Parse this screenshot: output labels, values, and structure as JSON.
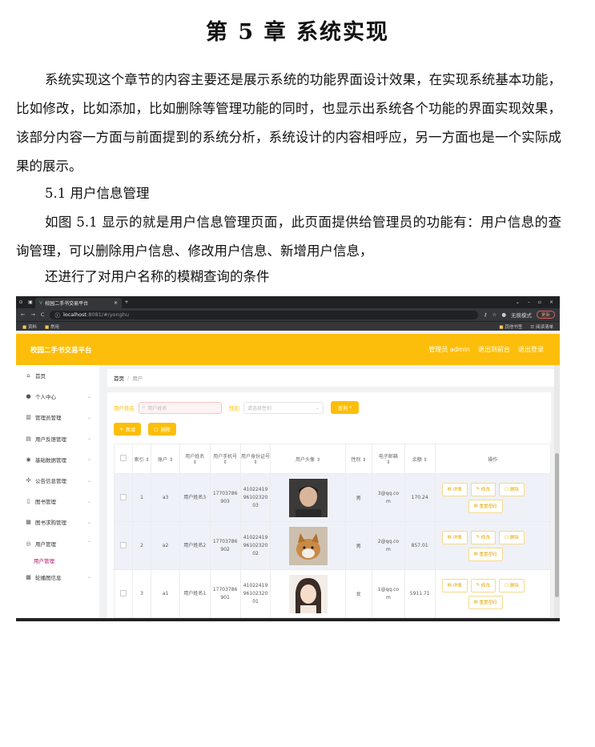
{
  "doc": {
    "chapter_title": "第 5 章  系统实现",
    "para1": "系统实现这个章节的内容主要还是展示系统的功能界面设计效果，在实现系统基本功能，比如修改，比如添加，比如删除等管理功能的同时，也显示出系统各个功能的界面实现效果，该部分内容一方面与前面提到的系统分析，系统设计的内容相呼应，另一方面也是一个实际成果的展示。",
    "section": "5.1 用户信息管理",
    "para2": "如图 5.1 显示的就是用户信息管理页面，此页面提供给管理员的功能有：用户信息的查询管理，可以删除用户信息、修改用户信息、新增用户信息，",
    "para3": "还进行了对用户名称的模糊查询的条件"
  },
  "browser": {
    "tab_title": "校园二手书交易平台",
    "new_tab": "+",
    "url_host": "localhost",
    "url_rest": ":8081/#/yonghu",
    "incognito": "无痕模式",
    "update": "更新",
    "bookmarks": [
      "资料",
      "常用"
    ],
    "bookmarks_right": [
      "其他书签",
      "阅读清单"
    ]
  },
  "app": {
    "brand": "校园二手书交易平台",
    "header_links": [
      "管理员 admin",
      "退出到前台",
      "退出登录"
    ],
    "sidebar": [
      {
        "label": "首页",
        "icon": "home-icon"
      },
      {
        "label": "个人中心",
        "icon": "user-icon"
      },
      {
        "label": "管理员管理",
        "icon": "chart-icon"
      },
      {
        "label": "用户反馈管理",
        "icon": "list-icon"
      },
      {
        "label": "基础数据管理",
        "icon": "pin-icon"
      },
      {
        "label": "公告信息管理",
        "icon": "megaphone-icon"
      },
      {
        "label": "图书管理",
        "icon": "book-icon"
      },
      {
        "label": "图书求购管理",
        "icon": "cart-icon"
      },
      {
        "label": "用户管理",
        "icon": "users-icon"
      },
      {
        "label": "用户管理",
        "icon": ""
      },
      {
        "label": "轮播图信息",
        "icon": "image-icon"
      }
    ],
    "breadcrumb": {
      "home": "首页",
      "sep": "/",
      "current": "用户"
    },
    "search": {
      "name_label": "用户姓名",
      "name_placeholder": "用户姓名",
      "gender_label": "性别",
      "gender_placeholder": "请选择性别",
      "query_button": "查询"
    },
    "add_button": "新增",
    "delete_button": "删除",
    "columns": [
      "索引",
      "账户",
      "用户姓名",
      "用户手机号",
      "用户身份证号",
      "用户头像",
      "性别",
      "电子邮箱",
      "余额",
      "操作"
    ],
    "rows": [
      {
        "index": "1",
        "account": "a3",
        "name": "用户姓名3",
        "phone": "17703786903",
        "idcard": "410224199610232003",
        "gender": "男",
        "email": "3@qq.com",
        "balance": "170.24",
        "avatar": "man"
      },
      {
        "index": "2",
        "account": "a2",
        "name": "用户姓名2",
        "phone": "17703786902",
        "idcard": "410224199610232002",
        "gender": "男",
        "email": "2@qq.com",
        "balance": "857.01",
        "avatar": "dog"
      },
      {
        "index": "3",
        "account": "a1",
        "name": "用户姓名1",
        "phone": "17703786901",
        "idcard": "410224199610232001",
        "gender": "女",
        "email": "1@qq.com",
        "balance": "5911.71",
        "avatar": "woman"
      }
    ],
    "ops": {
      "detail": "详情",
      "edit": "修改",
      "delete": "删除",
      "reset": "重置密码"
    }
  }
}
